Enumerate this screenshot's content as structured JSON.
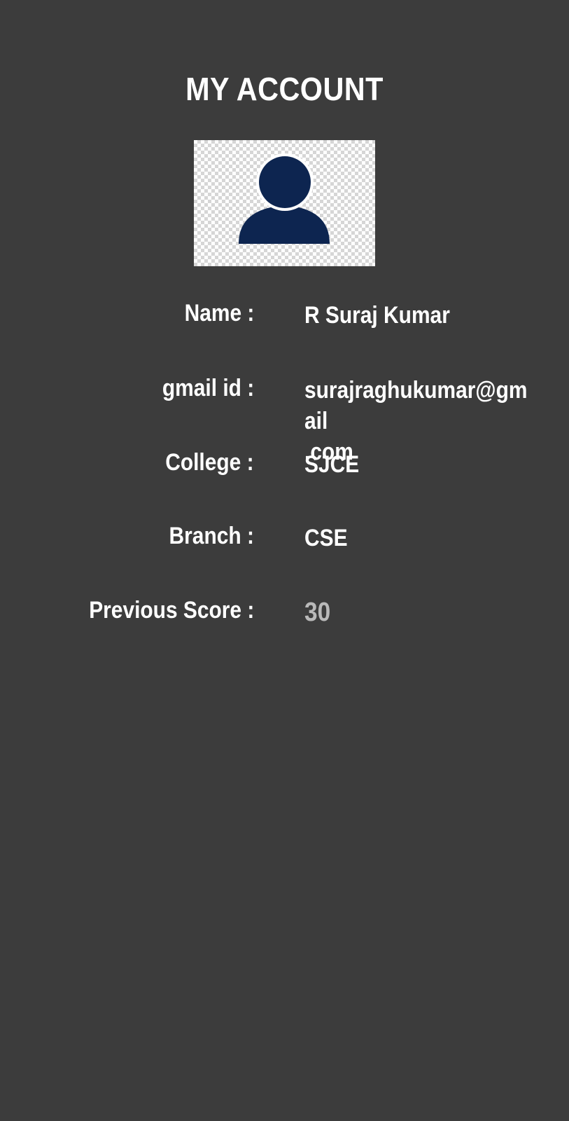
{
  "header": {
    "title": "MY ACCOUNT"
  },
  "avatar": {
    "icon": "user-avatar-icon",
    "color": "#0d2550"
  },
  "profile": {
    "name_label": "Name :",
    "name_value": "R Suraj Kumar",
    "gmail_label": "gmail id :",
    "gmail_value_line1": "surajraghukumar@gmail",
    "gmail_value_line2": ".com",
    "college_label": "College :",
    "college_value": "SJCE",
    "branch_label": "Branch :",
    "branch_value": "CSE",
    "score_label": "Previous Score :",
    "score_value": "30"
  },
  "colors": {
    "background": "#3c3c3c",
    "text": "#ffffff",
    "score_text": "#b9b9b9"
  }
}
